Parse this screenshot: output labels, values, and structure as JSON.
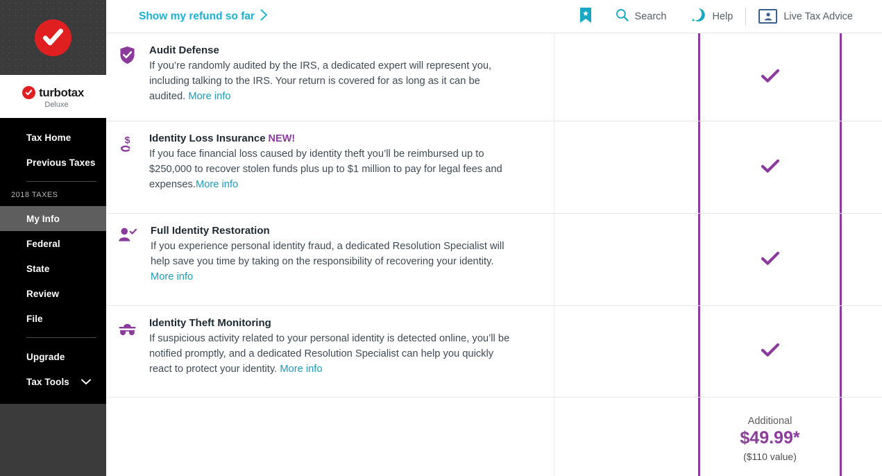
{
  "brand": {
    "accent_purple": "#8a3b9b",
    "accent_teal": "#1ab2d4",
    "accent_red": "#e01f21",
    "logo_word": "turbotax",
    "logo_dot": ".",
    "edition": "Deluxe"
  },
  "sidebar": {
    "items": [
      {
        "label": "Tax Home",
        "active": false
      },
      {
        "label": "Previous Taxes",
        "active": false
      }
    ],
    "section_label": "2018 TAXES",
    "tax_items": [
      {
        "label": "My Info",
        "active": true
      },
      {
        "label": "Federal",
        "active": false
      },
      {
        "label": "State",
        "active": false
      },
      {
        "label": "Review",
        "active": false
      },
      {
        "label": "File",
        "active": false
      }
    ],
    "footer_items": [
      {
        "label": "Upgrade",
        "chevron": false
      },
      {
        "label": "Tax Tools",
        "chevron": true
      }
    ]
  },
  "topbar": {
    "refund_link": "Show my refund so far",
    "bookmark_icon": "bookmark-icon",
    "search_label": "Search",
    "help_label": "Help",
    "live_tax_advice_label": "Live Tax Advice"
  },
  "table": {
    "rows": [
      {
        "icon": "shield-check-icon",
        "title": "Audit Defense",
        "new_tag": "",
        "desc": "If you’re randomly audited by the IRS, a dedicated expert will represent you, including talking to the IRS. Your return is covered for as long as it can be audited. ",
        "more_info": "More info",
        "mid_mark": "",
        "hi_mark": "check"
      },
      {
        "icon": "hand-dollar-icon",
        "title": "Identity Loss Insurance",
        "new_tag": "NEW!",
        "desc": "If you face financial loss caused by identity theft you’ll be reimbursed up to $250,000 to recover stolen funds plus up to $1 million to pay for legal fees and expenses.",
        "more_info": "More info",
        "mid_mark": "",
        "hi_mark": "check"
      },
      {
        "icon": "user-check-icon",
        "title": "Full Identity Restoration",
        "new_tag": "",
        "desc": "If you experience personal identity fraud, a dedicated Resolution Specialist will help save you time by taking on the responsibility of recovering your identity. ",
        "more_info": "More info",
        "mid_mark": "",
        "hi_mark": "check"
      },
      {
        "icon": "detective-hat-icon",
        "title": "Identity Theft Monitoring",
        "new_tag": "",
        "desc": "If suspicious activity related to your personal identity is detected online, you’ll be notified promptly, and a dedicated Resolution Specialist can help you quickly react to protect your identity. ",
        "more_info": "More info",
        "mid_mark": "",
        "hi_mark": "check"
      }
    ],
    "price_row": {
      "label": "Additional",
      "amount": "$49.99*",
      "value_note": "($110 value)"
    }
  }
}
